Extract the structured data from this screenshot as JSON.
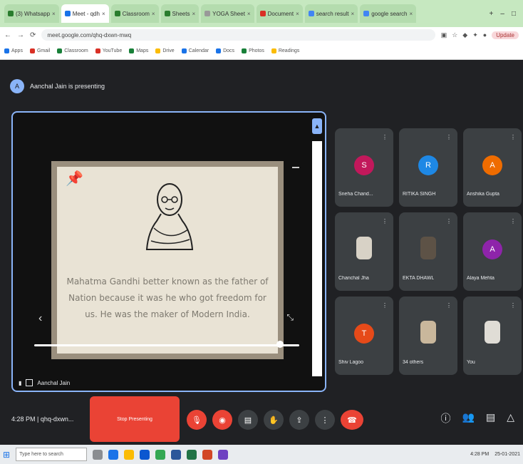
{
  "browser": {
    "tabs": [
      {
        "label": "(3) Whatsapp",
        "active": false
      },
      {
        "label": "Meet - qdh",
        "active": true
      },
      {
        "label": "Classroom",
        "active": false
      },
      {
        "label": "Sheets",
        "active": false
      },
      {
        "label": "YOGA Sheet",
        "active": false
      },
      {
        "label": "Document",
        "active": false
      },
      {
        "label": "search result",
        "active": false
      },
      {
        "label": "google search",
        "active": false
      }
    ],
    "url": "meet.google.com/qhq-dxwn-mwq",
    "profile_pill": "Update"
  },
  "bookmarks": [
    "Apps",
    "Gmail",
    "Classroom",
    "YouTube",
    "Maps",
    "Drive",
    "Calendar",
    "Docs",
    "Photos",
    "Readings"
  ],
  "meet": {
    "presenting_banner": "Aanchal Jain is presenting",
    "presenter_initial": "A",
    "slide_text": "Mahatma Gandhi better known as the father of Nation because it was he who got freedom for us. He was the maker of Modern India.",
    "presenter_name": "Aanchal Jain",
    "participants": [
      {
        "name": "Sneha Chand...",
        "initial": "S",
        "color": "#c2185b",
        "photo": false
      },
      {
        "name": "RITIKA SINGH",
        "initial": "R",
        "color": "#1e88e5",
        "photo": false
      },
      {
        "name": "Anshika Gupta",
        "initial": "A",
        "color": "#ef6c00",
        "photo": false
      },
      {
        "name": "Chanchal Jha",
        "initial": "",
        "color": "",
        "photo": true
      },
      {
        "name": "EKTA DHAWL",
        "initial": "",
        "color": "",
        "photo": true
      },
      {
        "name": "Alaya Mehta",
        "initial": "A",
        "color": "#8e24aa",
        "photo": false
      },
      {
        "name": "Shiv Lagoo",
        "initial": "T",
        "color": "#e64a19",
        "photo": false
      },
      {
        "name": "34 others",
        "initial": "",
        "color": "",
        "photo": true
      },
      {
        "name": "You",
        "initial": "",
        "color": "",
        "photo": true
      }
    ],
    "time_meeting": "4:28 PM | qhq-dxwn...",
    "stop_presenting_label": "Stop Presenting"
  },
  "taskbar": {
    "search_placeholder": "Type here to search",
    "time": "4:28 PM",
    "date": "25-01-2021"
  }
}
